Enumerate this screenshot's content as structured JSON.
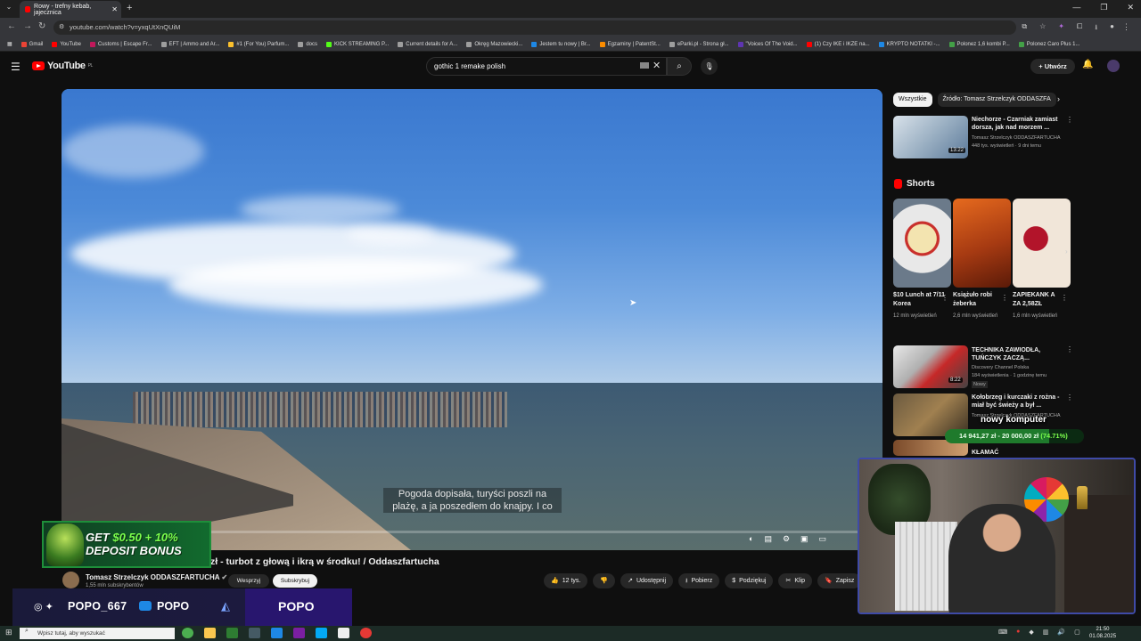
{
  "browser": {
    "tab_title": "Rowy - trefny kebab, jajecznica",
    "tab_close": "✕",
    "new_tab": "+",
    "url": "youtube.com/watch?v=yxqUtXnQUiM",
    "window_controls": [
      "—",
      "❐",
      "✕"
    ],
    "bookmarks": [
      {
        "label": "Gmail",
        "color": "#ea4335"
      },
      {
        "label": "YouTube",
        "color": "#ff0000"
      },
      {
        "label": "Customs | Escape Fr...",
        "color": "#c2185b"
      },
      {
        "label": "EFT | Ammo and Ar...",
        "color": "#9e9e9e"
      },
      {
        "label": "#1 (For You) Parfum...",
        "color": "#fbc02d"
      },
      {
        "label": "docs",
        "color": "#9e9e9e"
      },
      {
        "label": "KICK STREAMING P...",
        "color": "#53fc18"
      },
      {
        "label": "Current details for A...",
        "color": "#9e9e9e"
      },
      {
        "label": "Okręg Mazowiecki...",
        "color": "#9e9e9e"
      },
      {
        "label": "Jestem tu nowy | Br...",
        "color": "#1e88e5"
      },
      {
        "label": "Egzaminy | PatentSt...",
        "color": "#fb8c00"
      },
      {
        "label": "eParki.pl - Strona gł...",
        "color": "#9e9e9e"
      },
      {
        "label": "\"Voices Of The Void...",
        "color": "#5e35b1"
      },
      {
        "label": "(1) Czy IKE i IKZE na...",
        "color": "#ff0000"
      },
      {
        "label": "KRYPTO NOTATKI -...",
        "color": "#1e88e5"
      },
      {
        "label": "Polonez 1,6 kombi P...",
        "color": "#43a047"
      },
      {
        "label": "Polonez Caro Plus 1...",
        "color": "#43a047"
      }
    ]
  },
  "youtube": {
    "logo": "YouTube",
    "logo_region": "PL",
    "search_value": "gothic 1 remake polish",
    "create_label": "Utwórz",
    "video": {
      "subtitle_line1": "Pogoda dopisała, turyści poszli na",
      "subtitle_line2": "plażę, a ja poszedłem do knajpy. I co",
      "progress": 0.0
    },
    "title": "zł - turbot z głową i ikrą w środku! / Oddaszfartucha",
    "channel": {
      "name": "Tomasz Strzelczyk ODDASZFARTUCHA",
      "subs": "1,55 mln subskrybentów",
      "join_label": "Wesprzyj",
      "subscribe_label": "Subskrybuj"
    },
    "actions": [
      {
        "icon": "👍",
        "label": "12 tys."
      },
      {
        "icon": "👎",
        "label": ""
      },
      {
        "icon": "↗",
        "label": "Udostępnij"
      },
      {
        "icon": "⭳",
        "label": "Pobierz"
      },
      {
        "icon": "$",
        "label": "Podziękuj"
      },
      {
        "icon": "✂",
        "label": "Klip"
      },
      {
        "icon": "🔖",
        "label": "Zapisz"
      }
    ],
    "chips": [
      "Wszystkie",
      "Źródło: Tomasz Strzelczyk ODDASZFA"
    ],
    "recs": [
      {
        "title": "Niechorze - Czarniak zamiast dorsza, jak nad morzem ...",
        "channel": "Tomasz Strzelczyk ODDASZFARTUCHA",
        "meta": "448 tys. wyświetleń · 9 dni temu",
        "duration": "13:22",
        "badge": ""
      },
      {
        "title": "TECHNIKA ZAWIODŁA, TUŃCZYK ZACZĄ...",
        "channel": "Discovery Channel Polska",
        "meta": "184 wyświetlenia · 1 godzinę temu",
        "duration": "8:22",
        "badge": "Nowy"
      },
      {
        "title": "Kołobrzeg i kurczaki z rożna - miał być świeży a był ...",
        "channel": "Tomasz Strzelczyk ODDASZFARTUCHA",
        "meta": "",
        "duration": "",
        "badge": ""
      },
      {
        "title": "KŁAMAĆ",
        "channel": "",
        "meta": "",
        "duration": "",
        "badge": ""
      }
    ],
    "shorts_label": "Shorts",
    "shorts": [
      {
        "title": "$10 Lunch at 7/11 Korea",
        "views": "12 mln wyświetleń"
      },
      {
        "title": "Książuło robi żeberka",
        "views": "2,6 mln wyświetleń"
      },
      {
        "title": "ZAPIEKANK A ZA 2,58ZŁ",
        "views": "1,6 mln wyświetleń"
      }
    ]
  },
  "stream": {
    "ad_line1": "GET ",
    "ad_amount": "$0.50 + 10%",
    "ad_line2": "DEPOSIT BONUS",
    "social1": "POPO_667",
    "social2": "POPO",
    "social3": "POPO",
    "goal_title": "nowy komputer",
    "goal_text": "14 941,27 zł - 20 000,00 zł",
    "goal_pct": "(74.71%)"
  },
  "taskbar": {
    "search_placeholder": "Wpisz tutaj, aby wyszukać",
    "time": "21:50",
    "date": "01.08.2025"
  }
}
